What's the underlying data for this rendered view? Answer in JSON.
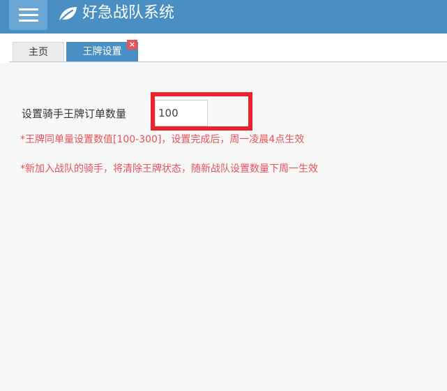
{
  "header": {
    "title": "好急战队系统",
    "menu_icon": "hamburger-menu-icon",
    "logo_icon": "leaf-icon"
  },
  "tabs": [
    {
      "label": "主页",
      "active": false
    },
    {
      "label": "王牌设置",
      "active": true,
      "close_label": "×"
    }
  ],
  "form": {
    "label": "设置骑手王牌订单数量",
    "value": "100"
  },
  "notes": [
    "*王牌同单量设置数值[100-300]，设置完成后，周一凌晨4点生效",
    "*新加入战队的骑手，将清除王牌状态，随新战队设置数量下周一生效"
  ],
  "colors": {
    "header": "#4a8fc4",
    "accent": "#4a8fc4",
    "note": "#e8525a",
    "highlight": "#e8252c"
  }
}
